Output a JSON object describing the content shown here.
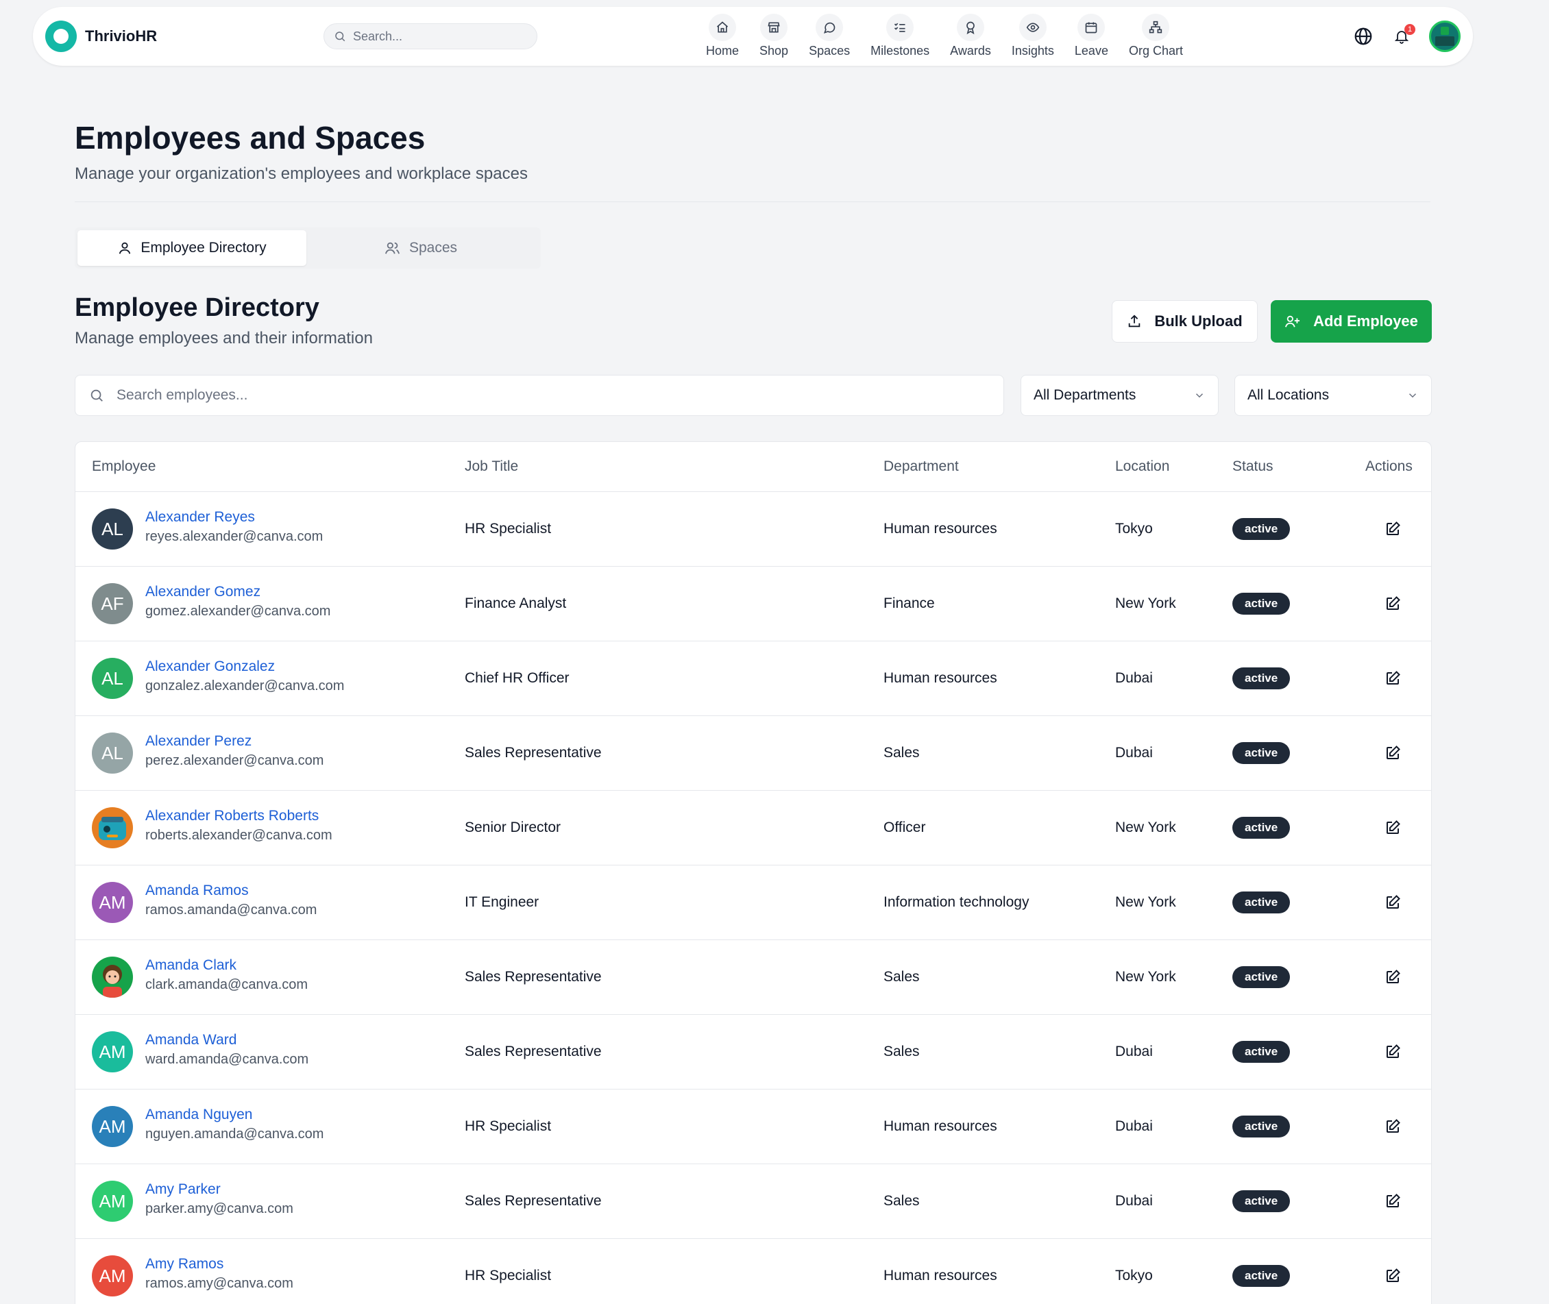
{
  "app": {
    "name": "ThrivioHR",
    "search_placeholder": "Search..."
  },
  "nav": [
    {
      "label": "Home",
      "icon": "home-icon"
    },
    {
      "label": "Shop",
      "icon": "store-icon"
    },
    {
      "label": "Spaces",
      "icon": "chat-bubble-icon"
    },
    {
      "label": "Milestones",
      "icon": "checklist-icon"
    },
    {
      "label": "Awards",
      "icon": "award-icon"
    },
    {
      "label": "Insights",
      "icon": "eye-icon"
    },
    {
      "label": "Leave",
      "icon": "calendar-icon"
    },
    {
      "label": "Org Chart",
      "icon": "org-chart-icon"
    }
  ],
  "notifications": {
    "count": "1"
  },
  "header": {
    "title": "Employees and Spaces",
    "subtitle": "Manage your organization's employees and workplace spaces"
  },
  "tabs": [
    {
      "label": "Employee Directory",
      "active": true
    },
    {
      "label": "Spaces",
      "active": false
    }
  ],
  "section": {
    "title": "Employee Directory",
    "subtitle": "Manage employees and their information",
    "bulk_upload_label": "Bulk Upload",
    "add_employee_label": "Add Employee"
  },
  "filters": {
    "search_placeholder": "Search employees...",
    "department_selected": "All Departments",
    "location_selected": "All Locations"
  },
  "table": {
    "columns": [
      "Employee",
      "Job Title",
      "Department",
      "Location",
      "Status",
      "Actions"
    ],
    "rows": [
      {
        "initials": "AL",
        "avatar_color": "#2d3e50",
        "name": "Alexander Reyes",
        "email": "reyes.alexander@canva.com",
        "job": "HR Specialist",
        "department": "Human resources",
        "location": "Tokyo",
        "status": "active"
      },
      {
        "initials": "AF",
        "avatar_color": "#7f8c8d",
        "name": "Alexander Gomez",
        "email": "gomez.alexander@canva.com",
        "job": "Finance Analyst",
        "department": "Finance",
        "location": "New York",
        "status": "active"
      },
      {
        "initials": "AL",
        "avatar_color": "#27ae60",
        "name": "Alexander Gonzalez",
        "email": "gonzalez.alexander@canva.com",
        "job": "Chief HR Officer",
        "department": "Human resources",
        "location": "Dubai",
        "status": "active"
      },
      {
        "initials": "AL",
        "avatar_color": "#95a5a6",
        "name": "Alexander Perez",
        "email": "perez.alexander@canva.com",
        "job": "Sales Representative",
        "department": "Sales",
        "location": "Dubai",
        "status": "active"
      },
      {
        "initials": "",
        "avatar_color": "#e67e22",
        "name": "Alexander Roberts Roberts",
        "email": "roberts.alexander@canva.com",
        "job": "Senior Director",
        "department": "Officer",
        "location": "New York",
        "status": "active"
      },
      {
        "initials": "AM",
        "avatar_color": "#9b59b6",
        "name": "Amanda Ramos",
        "email": "ramos.amanda@canva.com",
        "job": "IT Engineer",
        "department": "Information technology",
        "location": "New York",
        "status": "active"
      },
      {
        "initials": "",
        "avatar_color": "#16a34a",
        "name": "Amanda Clark",
        "email": "clark.amanda@canva.com",
        "job": "Sales Representative",
        "department": "Sales",
        "location": "New York",
        "status": "active"
      },
      {
        "initials": "AM",
        "avatar_color": "#1abc9c",
        "name": "Amanda Ward",
        "email": "ward.amanda@canva.com",
        "job": "Sales Representative",
        "department": "Sales",
        "location": "Dubai",
        "status": "active"
      },
      {
        "initials": "AM",
        "avatar_color": "#2980b9",
        "name": "Amanda Nguyen",
        "email": "nguyen.amanda@canva.com",
        "job": "HR Specialist",
        "department": "Human resources",
        "location": "Dubai",
        "status": "active"
      },
      {
        "initials": "AM",
        "avatar_color": "#2ecc71",
        "name": "Amy Parker",
        "email": "parker.amy@canva.com",
        "job": "Sales Representative",
        "department": "Sales",
        "location": "Dubai",
        "status": "active"
      },
      {
        "initials": "AM",
        "avatar_color": "#e74c3c",
        "name": "Amy Ramos",
        "email": "ramos.amy@canva.com",
        "job": "HR Specialist",
        "department": "Human resources",
        "location": "Tokyo",
        "status": "active"
      }
    ]
  }
}
